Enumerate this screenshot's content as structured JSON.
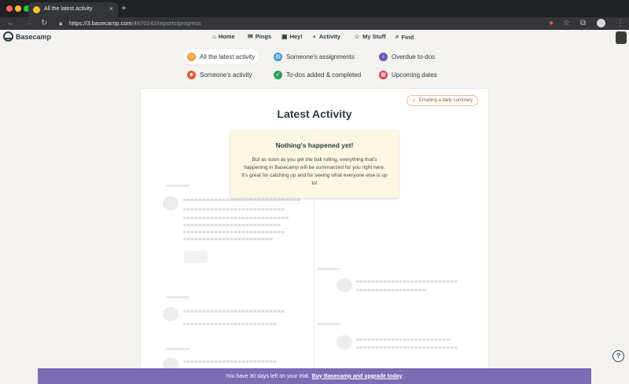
{
  "browser": {
    "tab_title": "All the latest activity",
    "tab_close": "×",
    "new_tab": "+",
    "url_host": "https://3.basecamp.com",
    "url_path": "/4870242/reports/progress"
  },
  "app": {
    "logo": "Basecamp",
    "nav": {
      "home": "Home",
      "pings": "Pings",
      "hey": "Hey!",
      "activity": "Activity",
      "my_stuff": "My Stuff",
      "find": "Find"
    }
  },
  "filters": {
    "latest": "All the latest activity",
    "assignments": "Someone's assignments",
    "overdue": "Overdue to-dos",
    "someones_activity": "Someone's activity",
    "todos": "To-dos added & completed",
    "upcoming": "Upcoming dates"
  },
  "card": {
    "title": "Latest Activity",
    "email_button": "Emailing a daily summary",
    "empty_title": "Nothing's happened yet!",
    "empty_body": "But as soon as you get the ball rolling, everything that's happening in Basecamp will be summarized for you right here. It's great for catching up and for seeing what everyone else is up to!"
  },
  "trial": {
    "text": "You have 30 days left on your trial.",
    "link": "Buy Basecamp and upgrade today",
    "end": "."
  },
  "help": "?",
  "colors": {
    "latest": "#f0a030",
    "assignments": "#3a9ad9",
    "overdue": "#6b5bb5",
    "someones_activity": "#e8562a",
    "todos": "#2e9e5b",
    "upcoming": "#e0394a",
    "trial_bar": "#7c6bb5"
  }
}
